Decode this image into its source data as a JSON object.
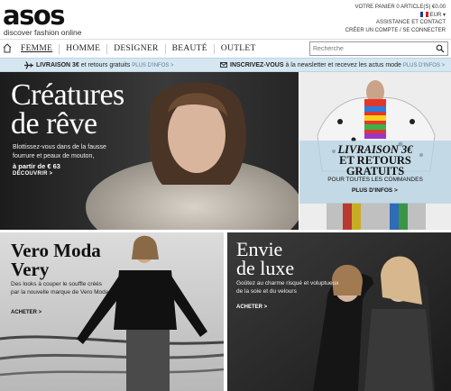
{
  "header": {
    "logo": "asos",
    "tagline": "discover fashion online",
    "cart": "VOTRE PANIER 0 ARTICLE(S) €0.00",
    "currency": "EUR",
    "help": "ASSISTANCE ET CONTACT",
    "account": "CRÉER UN COMPTE / SE CONNECTER"
  },
  "nav": {
    "items": [
      "FEMME",
      "HOMME",
      "DESIGNER",
      "BEAUTÉ",
      "OUTLET"
    ],
    "search_placeholder": "Recherche"
  },
  "promo": {
    "left_bold": "LIVRAISON 3€",
    "left_text": " et retours gratuits ",
    "left_more": "PLUS D'INFOS >",
    "right_bold": "INSCRIVEZ-VOUS",
    "right_text": " à la newsletter et recevez les actus mode ",
    "right_more": "PLUS D'INFOS >"
  },
  "hero": {
    "title_1": "Créatures",
    "title_2": "de rêve",
    "body": "Blottissez-vous dans de la fausse fourrure et peaux de mouton,",
    "price": "à partir de € 63",
    "cta": "DÉCOUVRIR >"
  },
  "delivery": {
    "title_1": "LIVRAISON 3€",
    "title_2": "ET RETOURS",
    "title_3": "GRATUITS",
    "subtitle": "POUR TOUTES LES COMMANDES",
    "cta": "PLUS D'INFOS >"
  },
  "vero": {
    "title_1": "Vero Moda",
    "title_2": "Very",
    "body": "Des looks à couper le souffle créés par la nouvelle marque de Vero Moda",
    "cta": "ACHETER >"
  },
  "luxe": {
    "title_1": "Envie",
    "title_2": "de luxe",
    "body": "Goûtez au charme risqué et voluptueux de la soie et du velours",
    "cta": "ACHETER >"
  },
  "colors": {
    "promo_bg": "#d6e7f1",
    "link_blue": "#5a7e99"
  }
}
